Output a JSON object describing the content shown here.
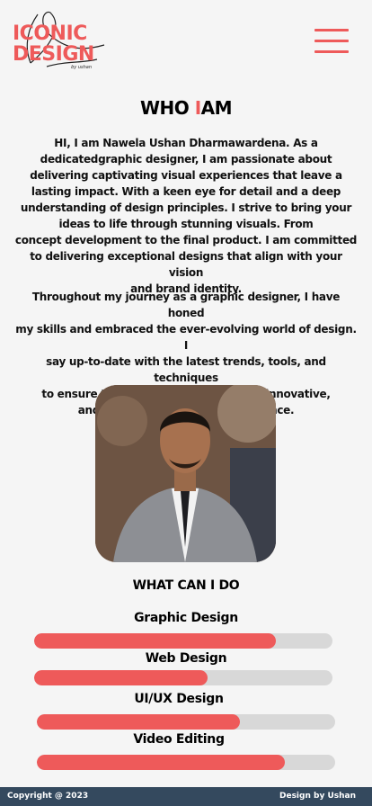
{
  "logo": {
    "line1": "ICONIC",
    "line2": "DESIGN",
    "byline": "by ushan"
  },
  "header": {
    "menu_icon": "hamburger-menu-icon",
    "accent_color": "#ee5a5a"
  },
  "about": {
    "title_part1": "WHO",
    "title_accent": "I",
    "title_part2": "AM",
    "paragraph1_lines": [
      "HI, I am Nawela Ushan Dharmawardena. As a",
      "dedicatedgraphic designer, I am passionate about",
      "delivering captivating visual experiences that leave a",
      "lasting impact. With a keen eye for detail and a deep",
      "understanding of design principles. I strive to bring your",
      "ideas to life through stunning visuals. From",
      "concept development to the final product. I am committed",
      "to delivering exceptional designs that align with your vision",
      "and brand identity."
    ],
    "paragraph2_lines": [
      "Throughout my journey as a graphic designer, I have honed",
      "my skills and embraced the ever-evolving world of design. I",
      "say up-to-date with the latest trends, tools, and techniques",
      "to ensure that my designs are freash, innovative,",
      "and tailored to your target audience."
    ]
  },
  "skills": {
    "title": "WHAT CAN I DO",
    "items": [
      {
        "label": "Graphic Design",
        "percent": 81
      },
      {
        "label": "Web Design",
        "percent": 58
      },
      {
        "label": "UI/UX Design",
        "percent": 68
      },
      {
        "label": "Video Editing",
        "percent": 83
      }
    ]
  },
  "footer": {
    "copyright": "Copyright @ 2023",
    "credit": "Design by Ushan",
    "background": "#34495e"
  }
}
